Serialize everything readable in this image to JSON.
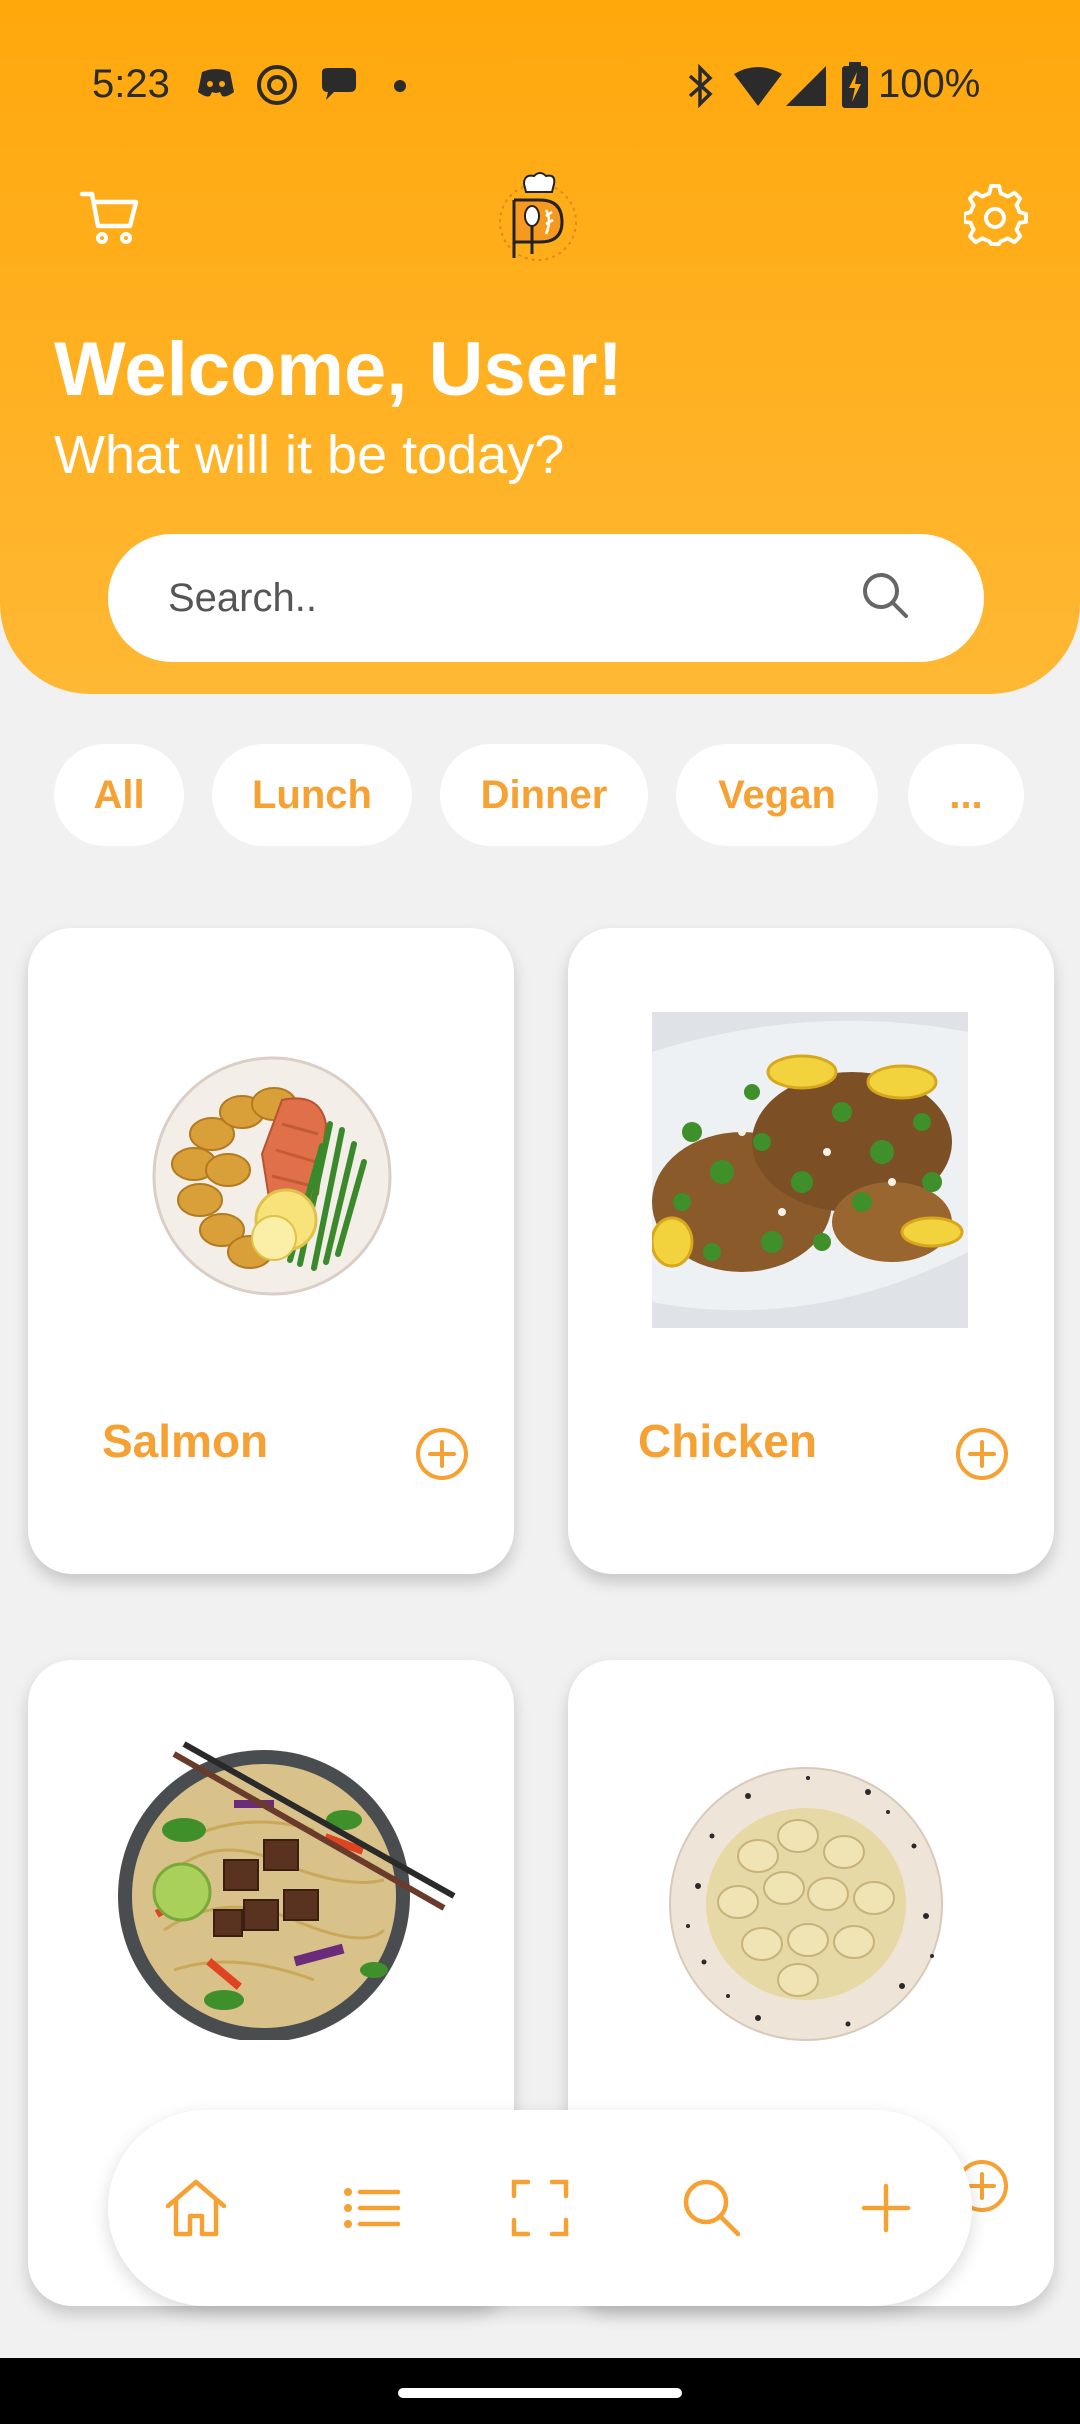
{
  "status": {
    "time": "5:23",
    "battery": "100%"
  },
  "header": {
    "welcome": "Welcome, User!",
    "subtitle": "What will it be today?"
  },
  "search": {
    "placeholder": "Search.."
  },
  "categories": [
    "All",
    "Lunch",
    "Dinner",
    "Vegan",
    "..."
  ],
  "recipes": [
    {
      "name": "Salmon"
    },
    {
      "name": "Chicken"
    },
    {
      "name": ""
    },
    {
      "name": ""
    }
  ],
  "bottom_nav": [
    "home-icon",
    "list-icon",
    "scan-icon",
    "search-icon",
    "plus-icon"
  ],
  "colors": {
    "accent": "#f5a133",
    "header": "#ffac18"
  }
}
